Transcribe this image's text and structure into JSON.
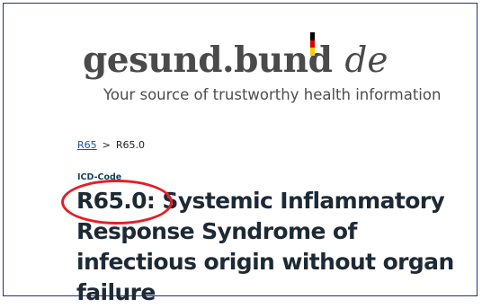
{
  "logo": {
    "main": "gesund.bund",
    "suffix": "de"
  },
  "tagline": "Your source of trustworthy health information",
  "breadcrumb": {
    "parent": "R65",
    "separator": ">",
    "current": "R65.0"
  },
  "icd_label": "ICD-Code",
  "title": "R65.0: Systemic Inflammatory Response Syndrome of infectious origin without organ failure",
  "colors": {
    "frame_border": "#2b2b8c",
    "highlight_circle": "#e31f26",
    "flag_black": "#000000",
    "flag_red": "#dd0000",
    "flag_gold": "#ffce00",
    "link": "#1f4fa3",
    "title": "#1d2a35"
  }
}
